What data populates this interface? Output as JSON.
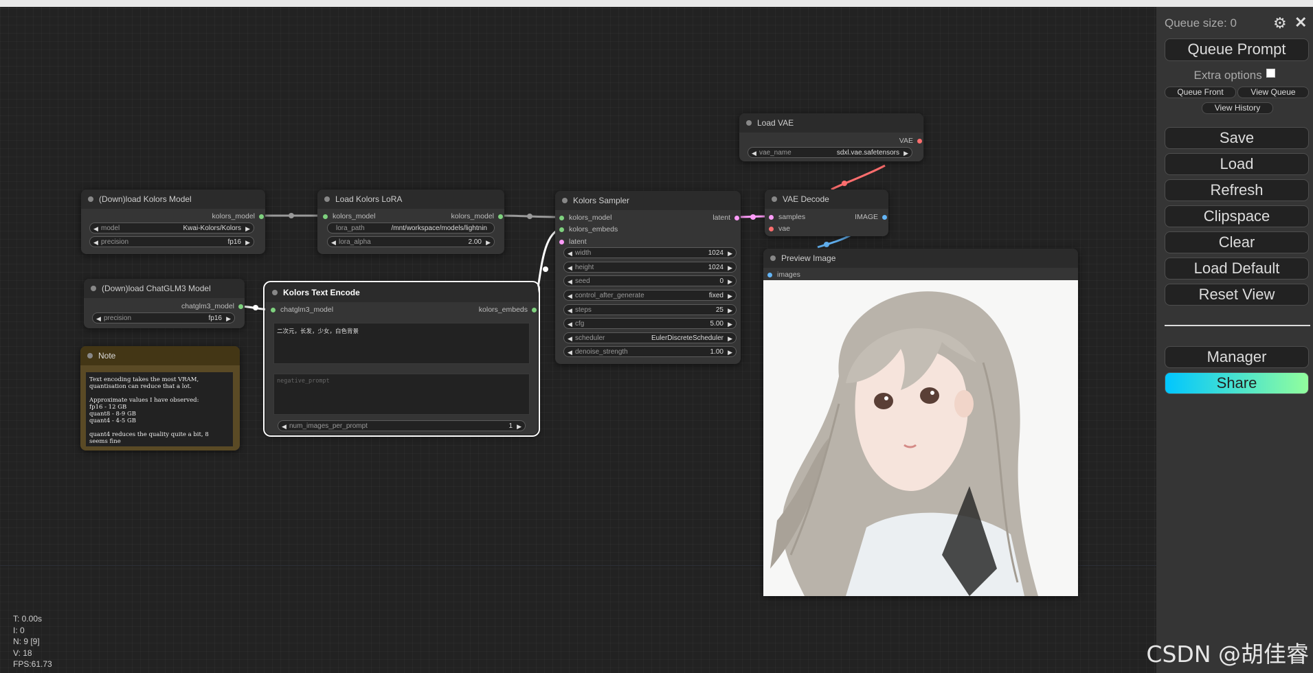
{
  "colors": {
    "canvas_bg": "#222222",
    "node_bg": "#353535",
    "node_title_bg": "#2b2b2b",
    "model_slot": "#7ed17e",
    "latent_slot": "#ff9cf9",
    "vae_slot": "#ff6e6e",
    "image_slot": "#64b5f6",
    "link_gray": "#9a9a9a",
    "link_white": "#ffffff",
    "share_gradient_start": "#00c6ff",
    "share_gradient_end": "#92fe9d"
  },
  "nodes": {
    "download_kolors": {
      "title": "(Down)load Kolors Model",
      "output": "kolors_model",
      "widgets": [
        {
          "name": "model",
          "value": "Kwai-Kolors/Kolors"
        },
        {
          "name": "precision",
          "value": "fp16"
        }
      ]
    },
    "load_lora": {
      "title": "Load Kolors LoRA",
      "input": "kolors_model",
      "output": "kolors_model",
      "lora_path": {
        "name": "lora_path",
        "value": "/mnt/workspace/models/lightnin"
      },
      "lora_alpha": {
        "name": "lora_alpha",
        "value": "2.00"
      }
    },
    "download_chatglm": {
      "title": "(Down)load ChatGLM3 Model",
      "output": "chatglm3_model",
      "widgets": [
        {
          "name": "precision",
          "value": "fp16"
        }
      ]
    },
    "text_encode": {
      "title": "Kolors Text Encode",
      "input": "chatglm3_model",
      "output": "kolors_embeds",
      "prompt": "二次元，长发，少女，白色背景",
      "negative_placeholder": "negative_prompt",
      "num_images": {
        "name": "num_images_per_prompt",
        "value": "1"
      }
    },
    "note": {
      "title": "Note",
      "text": "Text encoding takes the most VRAM,\nquantisation can reduce that a lot.\n\nApproximate values I have observed:\nfp16 - 12 GB\nquant8 - 8-9 GB\nquant4 - 4-5 GB\n\nquant4 reduces the quality quite a bit, 8\nseems fine"
    },
    "sampler": {
      "title": "Kolors Sampler",
      "inputs": [
        "kolors_model",
        "kolors_embeds",
        "latent"
      ],
      "output": "latent",
      "widgets": [
        {
          "name": "width",
          "value": "1024"
        },
        {
          "name": "height",
          "value": "1024"
        },
        {
          "name": "seed",
          "value": "0"
        },
        {
          "name": "control_after_generate",
          "value": "fixed"
        },
        {
          "name": "steps",
          "value": "25"
        },
        {
          "name": "cfg",
          "value": "5.00"
        },
        {
          "name": "scheduler",
          "value": "EulerDiscreteScheduler"
        },
        {
          "name": "denoise_strength",
          "value": "1.00"
        }
      ]
    },
    "load_vae": {
      "title": "Load VAE",
      "output": "VAE",
      "widget": {
        "name": "vae_name",
        "value": "sdxl.vae.safetensors"
      }
    },
    "vae_decode": {
      "title": "VAE Decode",
      "inputs": [
        "samples",
        "vae"
      ],
      "output": "IMAGE"
    },
    "preview": {
      "title": "Preview Image",
      "input": "images"
    }
  },
  "stats": {
    "time": "T: 0.00s",
    "i": "I: 0",
    "n": "N: 9 [9]",
    "v": "V: 18",
    "fps": "FPS:61.73"
  },
  "menu": {
    "queue_size": "Queue size: 0",
    "queue_prompt": "Queue Prompt",
    "extra_options": "Extra options",
    "queue_front": "Queue Front",
    "view_queue": "View Queue",
    "view_history": "View History",
    "save": "Save",
    "load": "Load",
    "refresh": "Refresh",
    "clipspace": "Clipspace",
    "clear": "Clear",
    "load_default": "Load Default",
    "reset_view": "Reset View",
    "manager": "Manager",
    "share": "Share",
    "close_glyph": "✕"
  },
  "watermark": "CSDN @胡佳睿"
}
